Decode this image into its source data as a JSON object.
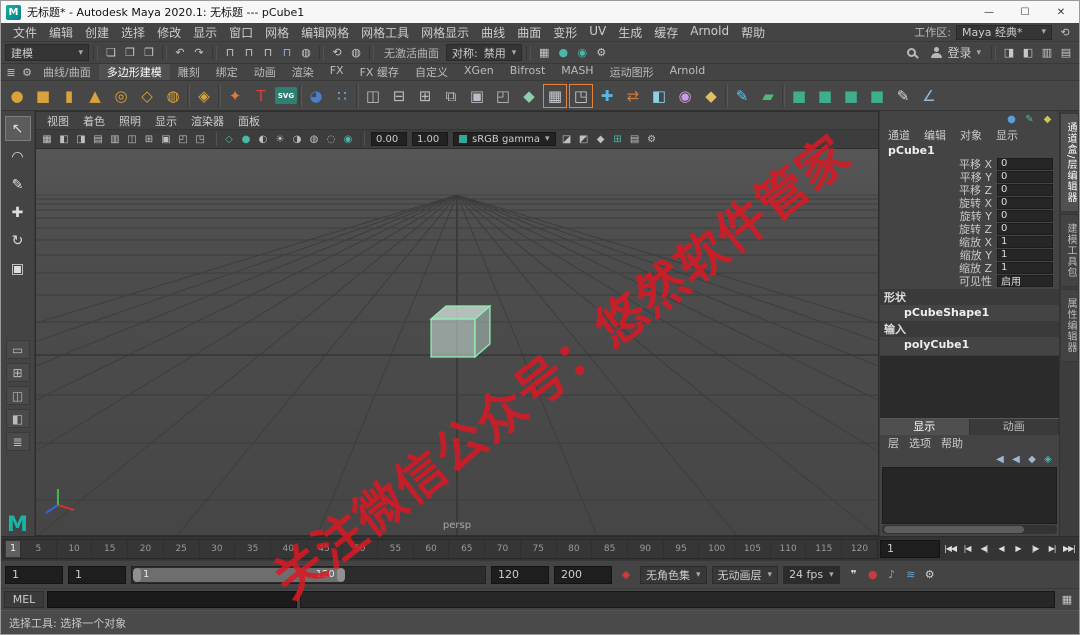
{
  "titlebar": {
    "app_initial": "M",
    "title": "无标题* - Autodesk Maya 2020.1: 无标题  ---  pCube1",
    "controls": [
      {
        "name": "minimize-button",
        "glyph": "—"
      },
      {
        "name": "maximize-button",
        "glyph": "☐"
      },
      {
        "name": "close-button",
        "glyph": "✕"
      }
    ]
  },
  "icons": {
    "caret": "▾",
    "gear": "⚙",
    "list": "≣",
    "script_editor": "▦",
    "reset": "⟲"
  },
  "menubar": {
    "items": [
      "文件",
      "编辑",
      "创建",
      "选择",
      "修改",
      "显示",
      "窗口",
      "网格",
      "编辑网格",
      "网格工具",
      "网格显示",
      "曲线",
      "曲面",
      "变形",
      "UV",
      "生成",
      "缓存",
      "Arnold",
      "帮助"
    ],
    "workspace_label": "工作区:",
    "workspace_value": "Maya 经典*"
  },
  "statusline": {
    "mode": "建模",
    "no_active_surface": "无激活曲面",
    "symmetry_label": "对称:",
    "symmetry_value": "禁用",
    "signin": "登录",
    "file_icons": [
      {
        "name": "new-scene-icon",
        "glyph": "❏",
        "color": "#c8c8c8"
      },
      {
        "name": "open-scene-icon",
        "glyph": "❐",
        "color": "#c8c8c8"
      },
      {
        "name": "save-scene-icon",
        "glyph": "❒",
        "color": "#c8c8c8"
      }
    ],
    "undo_icons": [
      {
        "name": "undo-icon",
        "glyph": "↶",
        "color": "#c8c8c8"
      },
      {
        "name": "redo-icon",
        "glyph": "↷",
        "color": "#c8c8c8"
      }
    ],
    "snap_icons": [
      {
        "name": "snap-to-grids-icon",
        "glyph": "⊓",
        "color": "#c8c8c8"
      },
      {
        "name": "snap-to-curves-icon",
        "glyph": "⊓",
        "color": "#c8c8c8"
      },
      {
        "name": "snap-to-points-icon",
        "glyph": "⊓",
        "color": "#c8c8c8"
      },
      {
        "name": "snap-to-view-planes-icon",
        "glyph": "⊓",
        "color": "#8fb8e0"
      },
      {
        "name": "make-live-icon",
        "glyph": "◍",
        "color": "#c8c8c8"
      }
    ],
    "history_icons": [
      {
        "name": "construction-history-icon",
        "glyph": "⟲",
        "color": "#c8c8c8"
      },
      {
        "name": "selection-highlight-icon",
        "glyph": "◍",
        "color": "#c8c8c8"
      }
    ],
    "render_icons": [
      {
        "name": "render-view-icon",
        "glyph": "▦",
        "color": "#c8c8c8"
      },
      {
        "name": "render-frame-icon",
        "glyph": "●",
        "color": "#49b8a8"
      },
      {
        "name": "ipr-render-icon",
        "glyph": "◉",
        "color": "#49b8a8"
      },
      {
        "name": "render-settings-icon",
        "glyph": "⚙",
        "color": "#c8c8c8"
      }
    ],
    "sidebar_toggles": [
      {
        "name": "attribute-editor-toggle-icon",
        "glyph": "◨",
        "color": "#c8c8c8"
      },
      {
        "name": "tool-settings-toggle-icon",
        "glyph": "◧",
        "color": "#c8c8c8"
      },
      {
        "name": "channel-box-toggle-icon",
        "glyph": "▥",
        "color": "#c8c8c8"
      },
      {
        "name": "modeling-toolkit-toggle-icon",
        "glyph": "▤",
        "color": "#c8c8c8"
      }
    ]
  },
  "shelf": {
    "tabs": [
      {
        "label": "曲线/曲面"
      },
      {
        "label": "多边形建模",
        "cls": "active"
      },
      {
        "label": "雕刻"
      },
      {
        "label": "绑定"
      },
      {
        "label": "动画"
      },
      {
        "label": "渲染"
      },
      {
        "label": "FX"
      },
      {
        "label": "FX 缓存"
      },
      {
        "label": "自定义"
      },
      {
        "label": "XGen"
      },
      {
        "label": "Bifrost"
      },
      {
        "label": "MASH"
      },
      {
        "label": "运动图形"
      },
      {
        "label": "Arnold"
      }
    ],
    "icons": [
      {
        "name": "poly-sphere-icon",
        "glyph": "●",
        "color": "#d9a33c"
      },
      {
        "name": "poly-cube-icon",
        "glyph": "■",
        "color": "#d9a33c"
      },
      {
        "name": "poly-cylinder-icon",
        "glyph": "▮",
        "color": "#d9a33c"
      },
      {
        "name": "poly-cone-icon",
        "glyph": "▲",
        "color": "#d9a33c"
      },
      {
        "name": "poly-torus-icon",
        "glyph": "◎",
        "color": "#d9a33c"
      },
      {
        "name": "poly-plane-icon",
        "glyph": "◇",
        "color": "#d9a33c"
      },
      {
        "name": "poly-disc-icon",
        "glyph": "◍",
        "color": "#d9a33c"
      },
      {
        "name": "shelf-separator",
        "cls": "sep"
      },
      {
        "name": "platonic-solid-icon",
        "glyph": "◈",
        "color": "#d9a33c"
      },
      {
        "name": "shelf-separator",
        "cls": "sep"
      },
      {
        "name": "sweep-mesh-icon",
        "glyph": "✦",
        "color": "#e07a38"
      },
      {
        "name": "type-tool-icon",
        "glyph": "T",
        "color": "#d84040"
      },
      {
        "name": "svg-tool-icon",
        "glyph": "SVG",
        "color": "#ffffff",
        "cls": "badge"
      },
      {
        "name": "shelf-separator",
        "cls": "sep"
      },
      {
        "name": "texture-sphere-icon",
        "glyph": "◕",
        "color": "#4a7ec8"
      },
      {
        "name": "uv-sample-icon",
        "glyph": "∷",
        "color": "#6fb9e0"
      },
      {
        "name": "shelf-separator",
        "cls": "sep"
      },
      {
        "name": "boolean-union-icon",
        "glyph": "◫",
        "color": "#b8bec4"
      },
      {
        "name": "boolean-difference-icon",
        "glyph": "⊟",
        "color": "#b8bec4"
      },
      {
        "name": "boolean-intersection-icon",
        "glyph": "⊞",
        "color": "#b8bec4"
      },
      {
        "name": "combine-icon",
        "glyph": "⧉",
        "color": "#b8bec4"
      },
      {
        "name": "separate-icon",
        "glyph": "▣",
        "color": "#b8bec4"
      },
      {
        "name": "extract-icon",
        "glyph": "◰",
        "color": "#b8bec4"
      },
      {
        "name": "bevel-icon",
        "glyph": "◆",
        "color": "#8ccfa8"
      },
      {
        "name": "bridge-icon",
        "glyph": "▦",
        "color": "#c8cdd2",
        "cls": "hl"
      },
      {
        "name": "extrude-icon",
        "glyph": "◳",
        "color": "#c8cdd2",
        "cls": "hl"
      },
      {
        "name": "multi-cut-icon",
        "glyph": "✚",
        "color": "#58b6d8"
      },
      {
        "name": "target-weld-icon",
        "glyph": "⇄",
        "color": "#d07a3a"
      },
      {
        "name": "mirror-icon",
        "glyph": "◧",
        "color": "#8fd0e8"
      },
      {
        "name": "smooth-icon",
        "glyph": "◉",
        "color": "#c8a0e0"
      },
      {
        "name": "crease-icon",
        "glyph": "◆",
        "color": "#e0c060"
      },
      {
        "name": "shelf-separator",
        "cls": "sep"
      },
      {
        "name": "quad-draw-icon",
        "glyph": "✎",
        "color": "#60c0f0"
      },
      {
        "name": "create-polygon-icon",
        "glyph": "▰",
        "color": "#50b878"
      },
      {
        "name": "shelf-separator",
        "cls": "sep"
      },
      {
        "name": "toolkit-move-icon",
        "glyph": "■",
        "color": "#3fae8f"
      },
      {
        "name": "toolkit-rotate-icon",
        "glyph": "■",
        "color": "#3fae8f"
      },
      {
        "name": "toolkit-scale-icon",
        "glyph": "■",
        "color": "#3fae8f"
      },
      {
        "name": "toolkit-select-icon",
        "glyph": "■",
        "color": "#3fae8f"
      },
      {
        "name": "paint-effects-icon",
        "glyph": "✎",
        "color": "#d8d8d8"
      },
      {
        "name": "measure-icon",
        "glyph": "∠",
        "color": "#9ab8d0"
      }
    ]
  },
  "toolbox": {
    "logo": "M",
    "tools": [
      {
        "name": "select-tool",
        "glyph": "↖",
        "cls": "active"
      },
      {
        "name": "lasso-select-tool",
        "glyph": "◠"
      },
      {
        "name": "paint-select-tool",
        "glyph": "✎"
      },
      {
        "name": "move-tool",
        "glyph": "✚"
      },
      {
        "name": "rotate-tool",
        "glyph": "↻"
      },
      {
        "name": "scale-tool",
        "glyph": "▣"
      }
    ],
    "layouts": [
      {
        "name": "single-pane-layout-button",
        "glyph": "▭"
      },
      {
        "name": "four-pane-layout-button",
        "glyph": "⊞"
      },
      {
        "name": "pane-outliner-layout-button",
        "glyph": "◫"
      },
      {
        "name": "split-pane-layout-button",
        "glyph": "◧"
      },
      {
        "name": "outliner-layout-button",
        "glyph": "≣"
      }
    ]
  },
  "viewport": {
    "panel_menus": [
      "视图",
      "着色",
      "照明",
      "显示",
      "渲染器",
      "面板"
    ],
    "exposure": "0.00",
    "gamma": "1.00",
    "colorspace": "sRGB gamma",
    "camera_label": "persp",
    "icons1": [
      {
        "name": "grease-pencil-icon",
        "glyph": "▦",
        "color": "#c0c0c0"
      },
      {
        "name": "camera-lock-icon",
        "glyph": "◧",
        "color": "#c0c0c0"
      },
      {
        "name": "film-gate-icon",
        "glyph": "◨",
        "color": "#c0c0c0"
      },
      {
        "name": "resolution-gate-icon",
        "glyph": "▤",
        "color": "#c0c0c0"
      },
      {
        "name": "gate-mask-icon",
        "glyph": "▥",
        "color": "#c0c0c0"
      },
      {
        "name": "field-chart-icon",
        "glyph": "◫",
        "color": "#c0c0c0"
      },
      {
        "name": "safe-action-icon",
        "glyph": "⊞",
        "color": "#c0c0c0"
      },
      {
        "name": "safe-title-icon",
        "glyph": "▣",
        "color": "#c0c0c0"
      },
      {
        "name": "frame-all-icon",
        "glyph": "◰",
        "color": "#c0c0c0"
      },
      {
        "name": "frame-selection-icon",
        "glyph": "◳",
        "color": "#c0c0c0"
      }
    ],
    "icons2": [
      {
        "name": "wireframe-icon",
        "glyph": "◇",
        "color": "#49b8a8"
      },
      {
        "name": "shaded-icon",
        "glyph": "●",
        "color": "#49b8a8"
      },
      {
        "name": "textured-icon",
        "glyph": "◐",
        "color": "#c0c0c0"
      },
      {
        "name": "use-lights-icon",
        "glyph": "☀",
        "color": "#c0c0c0"
      },
      {
        "name": "shadows-icon",
        "glyph": "◑",
        "color": "#c0c0c0"
      },
      {
        "name": "ambient-occlusion-icon",
        "glyph": "◍",
        "color": "#c0c0c0"
      },
      {
        "name": "motion-blur-icon",
        "glyph": "◌",
        "color": "#c0c0c0"
      },
      {
        "name": "anti-aliasing-icon",
        "glyph": "◉",
        "color": "#49b8a8"
      }
    ],
    "icons3": [
      {
        "name": "isolate-select-icon",
        "glyph": "◪",
        "color": "#c0c0c0"
      },
      {
        "name": "xray-icon",
        "glyph": "◩",
        "color": "#c0c0c0"
      },
      {
        "name": "joints-xray-icon",
        "glyph": "◆",
        "color": "#c0c0c0"
      },
      {
        "name": "grid-toggle-icon",
        "glyph": "⊞",
        "color": "#49b8a8"
      },
      {
        "name": "hud-icon",
        "glyph": "▤",
        "color": "#c0c0c0"
      },
      {
        "name": "viewport-settings-icon",
        "glyph": "⚙",
        "color": "#c0c0c0"
      }
    ]
  },
  "rightpanel": {
    "header_icons": [
      {
        "name": "person-icon",
        "glyph": "●",
        "color": "#5a9fd8"
      },
      {
        "name": "pencil-icon",
        "glyph": "✎",
        "color": "#49b8a8"
      },
      {
        "name": "key-icon",
        "glyph": "◆",
        "color": "#c8c850"
      }
    ]
  },
  "channelbox": {
    "menus": [
      "通道",
      "编辑",
      "对象",
      "显示"
    ],
    "node": "pCube1",
    "rows": [
      {
        "label": "平移 X",
        "value": "0"
      },
      {
        "label": "平移 Y",
        "value": "0"
      },
      {
        "label": "平移 Z",
        "value": "0"
      },
      {
        "label": "旋转 X",
        "value": "0"
      },
      {
        "label": "旋转 Y",
        "value": "0"
      },
      {
        "label": "旋转 Z",
        "value": "0"
      },
      {
        "label": "缩放 X",
        "value": "1"
      },
      {
        "label": "缩放 Y",
        "value": "1"
      },
      {
        "label": "缩放 Z",
        "value": "1"
      },
      {
        "label": "可见性",
        "value": "启用"
      }
    ],
    "shapes_header": "形状",
    "shape_name": "pCubeShape1",
    "inputs_header": "输入",
    "input_name": "polyCube1"
  },
  "layers": {
    "tabs": [
      {
        "label": "显示",
        "cls": "active"
      },
      {
        "label": "动画"
      }
    ],
    "menus": [
      "层",
      "选项",
      "帮助"
    ],
    "icons": [
      {
        "name": "move-layer-up-icon",
        "glyph": "◀",
        "color": "#9ab8d8"
      },
      {
        "name": "move-layer-down-icon",
        "glyph": "◀",
        "color": "#9ab8d8"
      },
      {
        "name": "empty-layer-icon",
        "glyph": "◆",
        "color": "#9ab8d8"
      },
      {
        "name": "layer-from-selected-icon",
        "glyph": "◈",
        "color": "#49b8a8"
      }
    ]
  },
  "sidebar_tabs": [
    {
      "label": "通道盒/层编辑器",
      "cls": "active"
    },
    {
      "label": "建模工具包"
    },
    {
      "label": "属性编辑器"
    }
  ],
  "timeline": {
    "current": "1",
    "current_field": "1",
    "ticks": [
      "5",
      "10",
      "15",
      "20",
      "25",
      "30",
      "35",
      "40",
      "45",
      "50",
      "55",
      "60",
      "65",
      "70",
      "75",
      "80",
      "85",
      "90",
      "95",
      "100",
      "105",
      "110",
      "115",
      "120"
    ],
    "transport": [
      {
        "name": "go-to-start-button",
        "glyph": "|◀◀"
      },
      {
        "name": "step-back-frame-button",
        "glyph": "|◀"
      },
      {
        "name": "step-back-key-button",
        "glyph": "◀|"
      },
      {
        "name": "play-backwards-button",
        "glyph": "◀"
      },
      {
        "name": "play-forwards-button",
        "glyph": "▶"
      },
      {
        "name": "step-forward-key-button",
        "glyph": "|▶"
      },
      {
        "name": "step-forward-frame-button",
        "glyph": "▶|"
      },
      {
        "name": "go-to-end-button",
        "glyph": "▶▶|"
      }
    ]
  },
  "range": {
    "anim_start": "1",
    "play_start": "1",
    "inner_start": "1",
    "inner_end": "120",
    "play_end": "120",
    "anim_end": "200",
    "charset": "无角色集",
    "animlayer": "无动画层",
    "fps": "24 fps",
    "icons": [
      {
        "name": "comment-bubble-icon",
        "glyph": "❞",
        "color": "#d8d8d8"
      },
      {
        "name": "auto-keyframe-icon",
        "glyph": "●",
        "color": "#c83c3c"
      },
      {
        "name": "audio-icon",
        "glyph": "♪",
        "color": "#5cc878"
      },
      {
        "name": "cached-playback-icon",
        "glyph": "≋",
        "color": "#58a8d8"
      },
      {
        "name": "animation-preferences-icon",
        "glyph": "⚙",
        "color": "#d0d0d0"
      }
    ],
    "set_key_icon": "◆"
  },
  "command": {
    "label": "MEL"
  },
  "helpline": {
    "text": "选择工具: 选择一个对象"
  },
  "watermark": {
    "text": "关注微信公众号：悠然软件管家",
    "color": "#db1924"
  }
}
